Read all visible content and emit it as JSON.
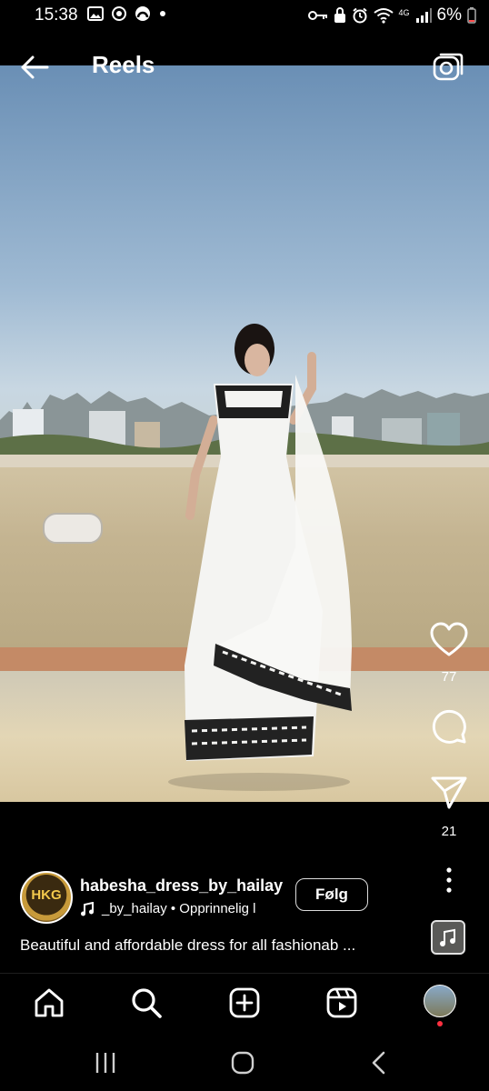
{
  "status_bar": {
    "time": "15:38",
    "battery": "6%",
    "network_label": "4G",
    "left_icons": [
      "image-icon",
      "at-sign-icon",
      "arc-icon",
      "dot-icon"
    ],
    "right_icons": [
      "key-icon",
      "lock-icon",
      "alarm-icon",
      "wifi-icon",
      "signal-icon",
      "battery-icon"
    ]
  },
  "header": {
    "title": "Reels"
  },
  "reel": {
    "author": {
      "avatar_text": "HKG",
      "username": "habesha_dress_by_hailay",
      "audio": "_by_hailay • Opprinnelig l",
      "follow_label": "Følg"
    },
    "caption": "Beautiful and affordable dress for all  fashionab ...",
    "likes": "77",
    "shares": "21"
  },
  "tabbar": {
    "tabs": [
      "home-tab",
      "search-tab",
      "create-tab",
      "reels-tab",
      "profile-tab"
    ]
  },
  "colors": {
    "background": "#000000",
    "text": "#ffffff",
    "notification_dot": "#ff3040"
  }
}
